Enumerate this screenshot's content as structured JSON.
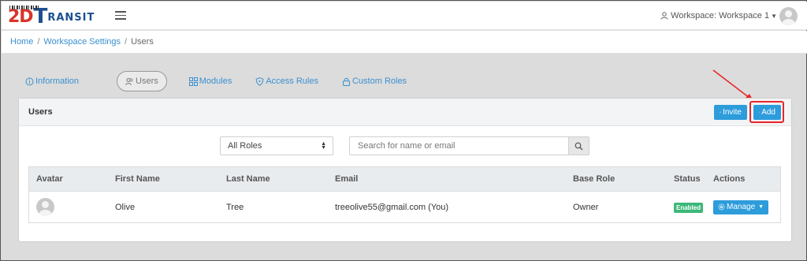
{
  "header": {
    "logo": {
      "part1": "2D",
      "part2": "T",
      "part3": "RANSIT",
      "colors": {
        "red": "#d8332a",
        "blue": "#1b4f8f"
      }
    },
    "menu_icon": "hamburger-icon",
    "workspace_label": "Workspace: Workspace 1"
  },
  "breadcrumb": {
    "items": [
      "Home",
      "Workspace Settings"
    ],
    "current": "Users",
    "separator": "/"
  },
  "tabs": [
    {
      "label": "Information",
      "icon": "info-circle-icon",
      "active": false
    },
    {
      "label": "Users",
      "icon": "users-icon",
      "active": true
    },
    {
      "label": "Modules",
      "icon": "grid-icon",
      "active": false
    },
    {
      "label": "Access Rules",
      "icon": "shield-icon",
      "active": false
    },
    {
      "label": "Custom Roles",
      "icon": "lock-icon",
      "active": false
    }
  ],
  "card": {
    "title": "Users",
    "invite_label": "Invite",
    "add_label": "Add"
  },
  "filters": {
    "role_select_value": "All Roles",
    "search_placeholder": "Search for name or email"
  },
  "table": {
    "columns": [
      "Avatar",
      "First Name",
      "Last Name",
      "Email",
      "Base Role",
      "Status",
      "Actions"
    ],
    "rows": [
      {
        "first_name": "Olive",
        "last_name": "Tree",
        "email": "treeolive55@gmail.com (You)",
        "base_role": "Owner",
        "status": "Enabled",
        "action_label": "Manage"
      }
    ]
  },
  "colors": {
    "primary": "#2d9cdb",
    "link": "#3a8fd0",
    "status_enabled": "#3cb878",
    "highlight": "#e8262a"
  }
}
